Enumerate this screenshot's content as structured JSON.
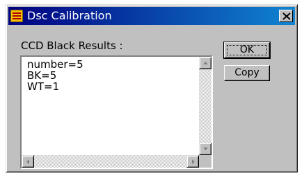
{
  "window": {
    "title": "Dsc Calibration",
    "icon": "dsc-cal-app-icon",
    "close_icon": "close-x-icon"
  },
  "dialog": {
    "label": "CCD Black Results :",
    "results": [
      "number=5",
      "BK=5",
      "WT=1"
    ],
    "ok_label": "OK",
    "copy_label": "Copy"
  },
  "scrollbars": {
    "up_icon": "arrow-up-icon",
    "down_icon": "arrow-down-icon",
    "left_icon": "arrow-left-icon",
    "right_icon": "arrow-right-icon"
  },
  "colors": {
    "titlebar_start": "#000080",
    "titlebar_end": "#1084d0",
    "face": "#c0c0c0"
  }
}
